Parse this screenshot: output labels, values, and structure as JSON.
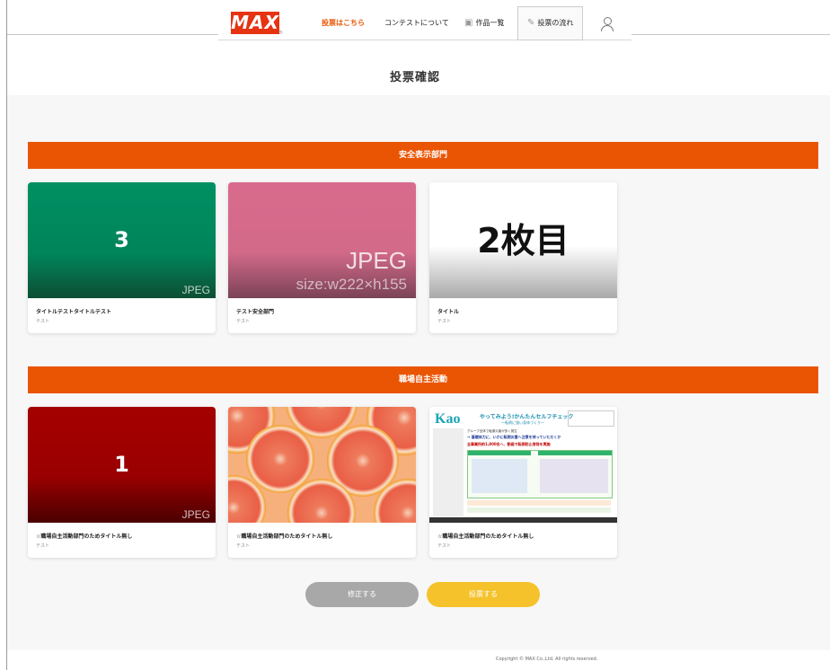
{
  "header": {
    "logo_text": "MAX",
    "logo_mark": "®",
    "nav": {
      "vote_here": "投票はこちら",
      "about_contest": "コンテストについて",
      "works_list": "作品一覧",
      "vote_flow": "投票の流れ"
    }
  },
  "page": {
    "title": "投票確認"
  },
  "sections": [
    {
      "title": "安全表示部門",
      "cards": [
        {
          "title": "タイトルテストタイトルテスト",
          "sub": "テスト",
          "thumb_text": "3",
          "thumb_label": "JPEG"
        },
        {
          "title": "テスト安全部門",
          "sub": "テスト",
          "thumb_text": "JPEG",
          "thumb_label": "size:w222×h155"
        },
        {
          "title": "タイトル",
          "sub": "テスト",
          "thumb_text": "2枚目"
        }
      ]
    },
    {
      "title": "職場自主活動",
      "cards": [
        {
          "title": "☆職場自主活動部門のためタイトル無し",
          "sub": "テスト",
          "thumb_text": "1",
          "thumb_label": "JPEG"
        },
        {
          "title": "☆職場自主活動部門のためタイトル無し",
          "sub": "テスト"
        },
        {
          "title": "☆職場自主活動部門のためタイトル無し",
          "sub": "テスト",
          "poster": {
            "brand": "Kao",
            "headline": "やってみよう!かんたんセルフチェック",
            "subhead": "～転倒に強い身体づくり～",
            "lines": [
              "グループ全体で転倒災害が多く発生",
              "→ 基礎体力に、いかに転倒災害へ注意を持っていただくか",
              "全事業所約1,800名へ、動画で転倒防止啓発を実施"
            ]
          }
        }
      ]
    }
  ],
  "actions": {
    "edit": "修正する",
    "vote": "投票する"
  },
  "footer": {
    "copyright": "Copyright © MAX Co.,Ltd. All rights reserved."
  },
  "colors": {
    "accent": "#ea5504",
    "vote_button": "#f5c22b",
    "edit_button": "#a8a8a8"
  }
}
